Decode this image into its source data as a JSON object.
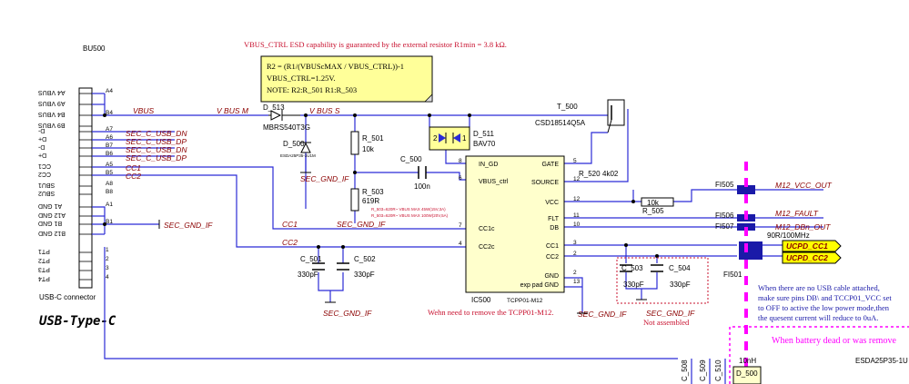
{
  "colors": {
    "wire": "#2b2bd6",
    "net_label": "#8b0000",
    "note_red": "#c8102e",
    "note_bg": "#ffff99",
    "dash_magenta": "#ff00ff",
    "port_fill": "#ffff00",
    "bus_block": "#1a1aa8"
  },
  "notes": {
    "esd": "VBUS_CTRL ESD capability is guaranteed by the external resistor R1min = 3.8 kΩ.",
    "box_l1": "R2 = (R1/(VBUScMAX / VBUS_CTRL))-1",
    "box_l2": "VBUS_CTRL=1.25V.",
    "box_l3": "NOTE:  R2:R_501      R1:R_503",
    "remove": "Wehn need to remove the TCPP01-M12.",
    "not_assembled": "Not assembled",
    "usb_line1": "When there are no USB cable attached,",
    "usb_line2": "make sure pins DB\\ and TCCP01_VCC set",
    "usb_line3": "to OFF to active the low power mode,then",
    "usb_line4": "the quesent current will reduce to 0uA.",
    "battery": "When battery dead or was remove",
    "r503_opt1": "R_503=620R~ VBUS MAX 45W(15V,3A)",
    "r503_opt2": "R_503=620R~ VBUS MAX 100W(20V,5A)"
  },
  "connector": {
    "ref": "BU500",
    "name": "USB-C connector",
    "title": "USB-Type-C",
    "pins_left": [
      "A4 VBUS",
      "A9 VBUS",
      "B4 VBUS",
      "B9 VBUS",
      "D-",
      "D+",
      "D-",
      "D+",
      "CC1",
      "CC2",
      "SBU1",
      "SBU2",
      "A1 GND",
      "A12 GND",
      "B1 GND",
      "B12 GND",
      "PT1",
      "PT2",
      "PT3",
      "PT4"
    ],
    "pin_nums": [
      "A4",
      "B4",
      "A7",
      "A6",
      "B7",
      "B6",
      "A5",
      "B5",
      "A8",
      "B8",
      "A1",
      "B1",
      "1",
      "2",
      "3",
      "4"
    ]
  },
  "nets": {
    "vbus": "VBUS",
    "vbus_m": "V BUS M",
    "vbus_s": "V BUS S",
    "usb_dn": "SEC_C_USB_DN",
    "usb_dp": "SEC_C_USB_DP",
    "cc1": "CC1",
    "cc2": "CC2",
    "cc1c": "CC1c",
    "cc2c": "CC2c",
    "gnd": "SEC_GND_IF",
    "m12_vcc": "M12_VCC_OUT",
    "m12_fault": "M12_FAULT",
    "m12_db": "M12_DBn_OUT",
    "ucpd_cc1": "UCPD_CC1",
    "ucpd_cc2": "UCPD_CC2"
  },
  "parts": {
    "d513": "D_513",
    "d513_val": "MBRS540T3G",
    "d500": "D_500",
    "d500_val": "ESDA25P35-1U1M",
    "r501": "R_501",
    "r501_val": "10k",
    "r503": "R_503",
    "r503_val": "619R",
    "c500": "C_500",
    "c500_val": "100n",
    "d511": "D_511",
    "d511_val": "BAV70",
    "t500": "T_500",
    "t500_val": "CSD18514Q5A",
    "r520": "R_520",
    "r520_val": "4k02",
    "r505": "R_505",
    "r505_val": "10k",
    "c501": "C_501",
    "c501_val": "330pF",
    "c502": "C_502",
    "c502_val": "330pF",
    "c503": "C_503",
    "c503_val": "330pF",
    "c504": "C_504",
    "c504_val": "330pF",
    "fi505": "FI505",
    "fi506": "FI506",
    "fi507": "FI507",
    "fi501": "FI501",
    "fi_val": "90R/100MHz",
    "c508": "C_508",
    "c509": "C_509",
    "c510": "C_510",
    "d_bottom": "D_500",
    "d_bottom_val": "10nH",
    "esd_bottom": "ESDA25P35-1U",
    "n1": "1",
    "n2": "2",
    "n3": "3",
    "n4": "4"
  },
  "ic": {
    "ref": "IC500",
    "name": "TCPP01-M12",
    "pins_left": [
      "IN_GD",
      "VBUS_ctrl",
      "CC1c",
      "CC2c"
    ],
    "pins_right": [
      "GATE",
      "SOURCE",
      "VCC",
      "FLT",
      "DB",
      "CC1",
      "CC2",
      "GND",
      "exp pad GND"
    ],
    "nums_left": [
      "8",
      "6",
      "7",
      "4"
    ],
    "nums_right": [
      "5",
      "12",
      "12",
      "11",
      "10",
      "3",
      "2",
      "2",
      "13"
    ]
  }
}
